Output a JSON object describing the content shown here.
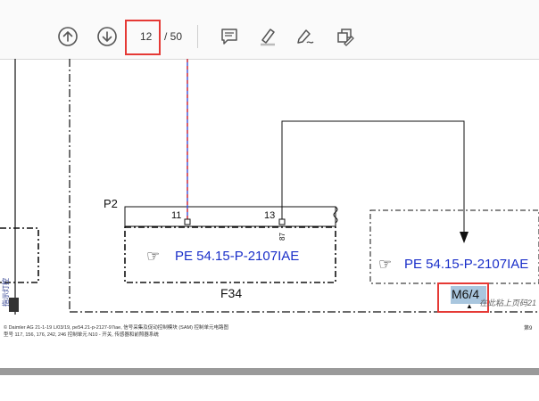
{
  "toolbar": {
    "page_current": "12",
    "page_total": "/ 50",
    "icons": [
      "arrow-up-circle-icon",
      "arrow-down-circle-icon",
      "comment-icon",
      "highlighter-icon",
      "pen-sign-icon",
      "share-edit-icon"
    ]
  },
  "diagram": {
    "p2_label": "P2",
    "pin_11": "11",
    "pin_13": "13",
    "pin_87": "87",
    "f34_label": "F34",
    "pe_left": "PE 54.15-P-2107IAE",
    "pe_right": "PE 54.15-P-2107IAE",
    "m64_label": "M6/4",
    "sticky_note": "在此粘上页码21",
    "vertical_text": "指示灯控"
  },
  "footer": {
    "line1": "© Daimler AG  21-1-19  L/03/19, pe54.21-p-2127-97iae, 信号采集及促动控制模块 (SAM) 控制单元电路图",
    "line2": "型号 117, 156, 176, 242, 246 控制单元 N10 - 开关, 传感器和前照器系统",
    "page_right": "第9"
  },
  "colors": {
    "link_blue": "#1a2fc9",
    "highlight_red": "#e53935",
    "wire_red": "#e53935",
    "wire_blue": "#3b4fd6"
  }
}
